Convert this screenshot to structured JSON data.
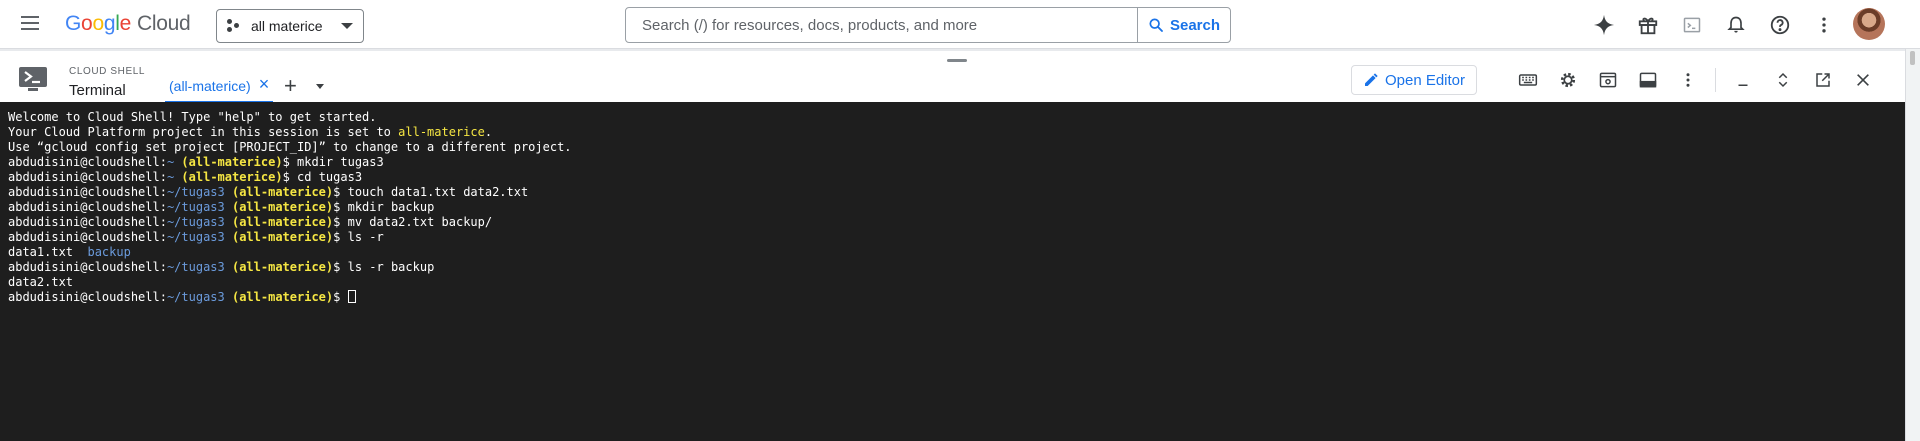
{
  "topbar": {
    "logo": {
      "g1": "G",
      "g2": "o",
      "g3": "o",
      "g4": "g",
      "g5": "l",
      "g6": "e",
      "product": "Cloud"
    },
    "project_picker": {
      "label": "all materice"
    },
    "search": {
      "placeholder": "Search (/) for resources, docs, products, and more",
      "button_label": "Search"
    },
    "icons": [
      "gemini-spark-icon",
      "gift-icon",
      "terminal-icon",
      "bell-icon",
      "help-icon",
      "more-vert-icon"
    ]
  },
  "shell": {
    "section_label": "CLOUD SHELL",
    "title": "Terminal",
    "tab_label": "(all-materice)",
    "tab_close": "×",
    "new_tab": "+",
    "open_editor_label": "Open Editor"
  },
  "terminal": {
    "welcome_1": "Welcome to Cloud Shell! Type \"help\" to get started.",
    "welcome_2_pre": "Your Cloud Platform project in this session is set to ",
    "welcome_2_proj": "all-materice",
    "welcome_2_post": ".",
    "welcome_3": "Use “gcloud config set project [PROJECT_ID]” to change to a different project.",
    "prompt_user": "abdudisini@cloudshell:",
    "home_path": "~",
    "tugas_path": "~/tugas3",
    "project_tag": "(all-materice)",
    "prompt_symbol": "$ ",
    "cmd_1": "mkdir tugas3",
    "cmd_2": "cd tugas3",
    "cmd_3": "touch data1.txt data2.txt",
    "cmd_4": "mkdir backup",
    "cmd_5": "mv data2.txt backup/",
    "cmd_6": "ls -r",
    "out_6_file": "data1.txt",
    "out_6_dir": "backup",
    "cmd_7": "ls -r backup",
    "out_7": "data2.txt"
  },
  "colors": {
    "accent": "#1a73e8",
    "terminal_bg": "#1e1e1e",
    "terminal_path": "#6b9bdc",
    "terminal_project": "#f5e643"
  }
}
